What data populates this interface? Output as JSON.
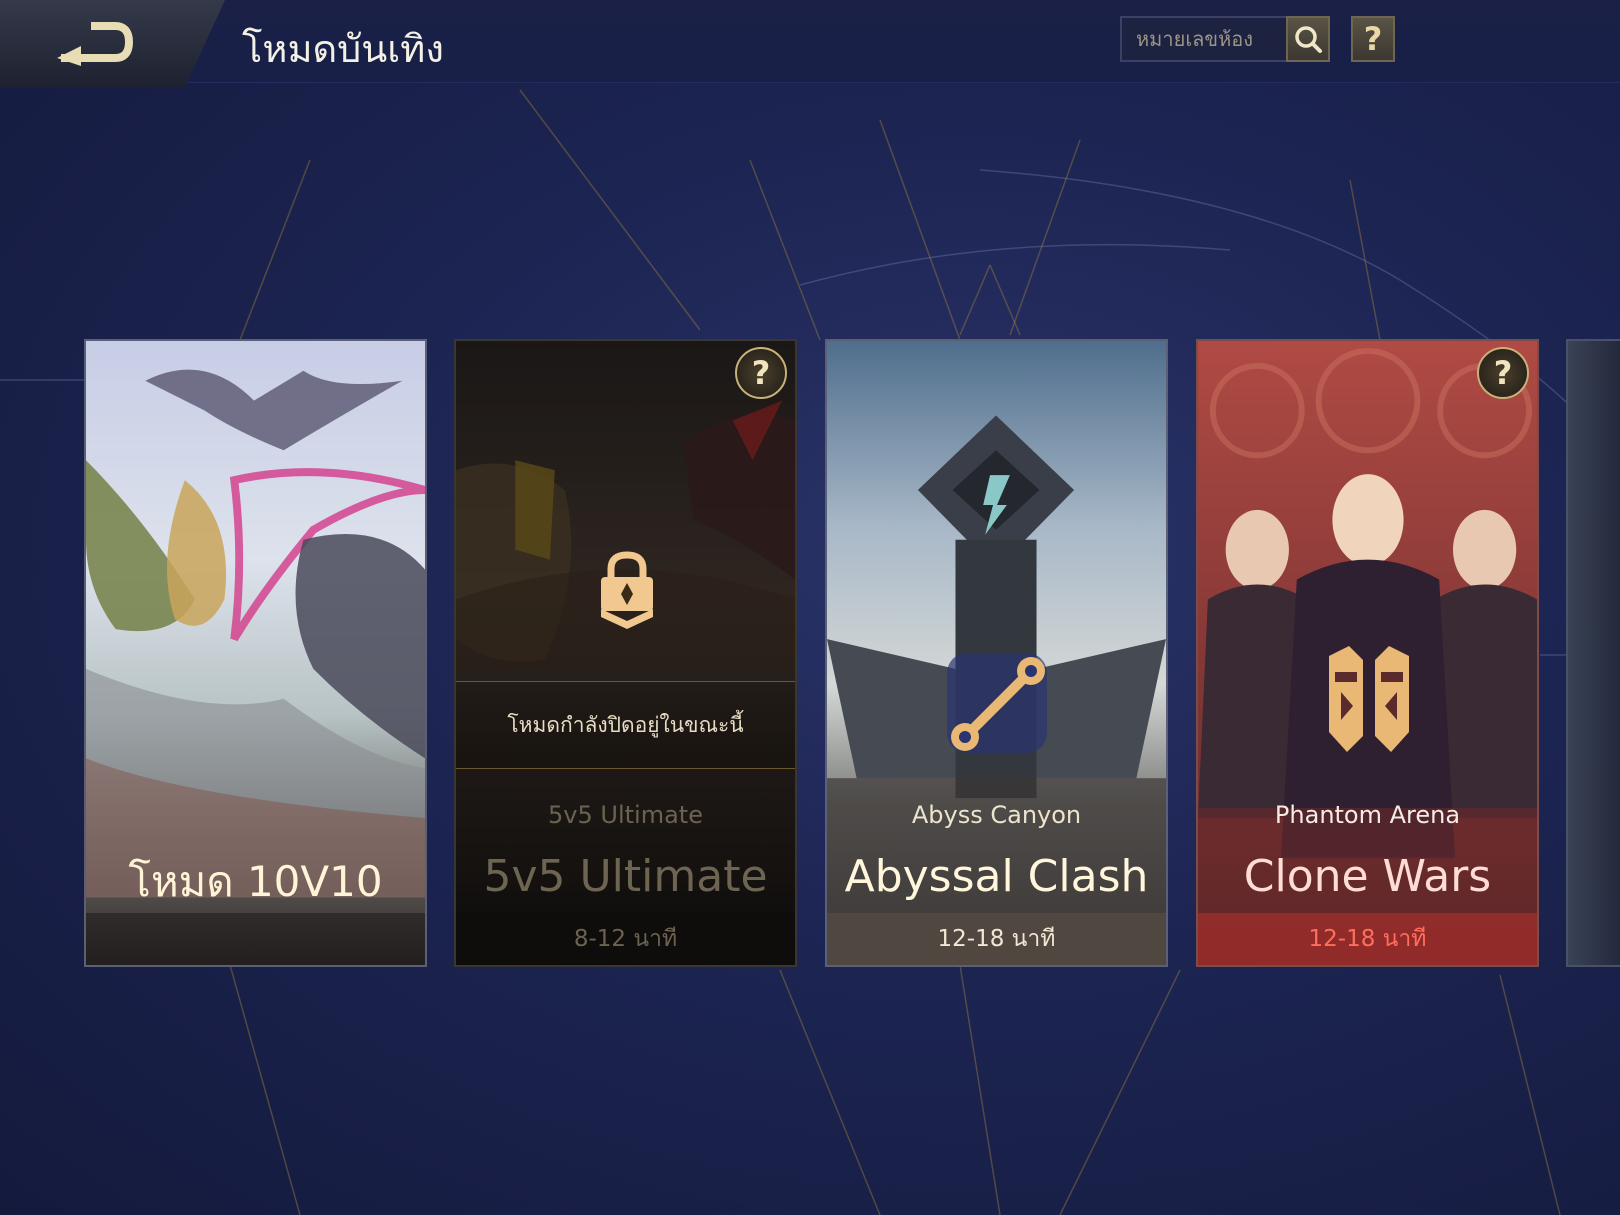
{
  "header": {
    "title": "โหมดบันเทิง",
    "search_placeholder": "หมายเลขห้อง",
    "help_label": "?"
  },
  "cards": [
    {
      "id": "10v10",
      "name": "โหมด 10V10",
      "subtitle": "",
      "duration": "",
      "state": "open"
    },
    {
      "id": "5v5-ultimate",
      "name": "5v5 Ultimate",
      "subtitle": "5v5 Ultimate",
      "duration": "8-12 นาที",
      "state": "closed",
      "closed_message": "โหมดกำลังปิดอยู่ในขณะนี้",
      "help_label": "?"
    },
    {
      "id": "abyssal-clash",
      "name": "Abyssal Clash",
      "subtitle": "Abyss Canyon",
      "duration": "12-18 นาที",
      "state": "open"
    },
    {
      "id": "clone-wars",
      "name": "Clone Wars",
      "subtitle": "Phantom Arena",
      "duration": "12-18 นาที",
      "state": "open",
      "help_label": "?"
    }
  ],
  "colors": {
    "background": "#1c2452",
    "gold_accent": "#c9b27a",
    "clone_wars_duration": "#ff6e5c"
  },
  "icons": [
    "back-arrow-icon",
    "search-icon",
    "help-icon",
    "lock-icon",
    "link-icon",
    "clone-mask-icon"
  ]
}
